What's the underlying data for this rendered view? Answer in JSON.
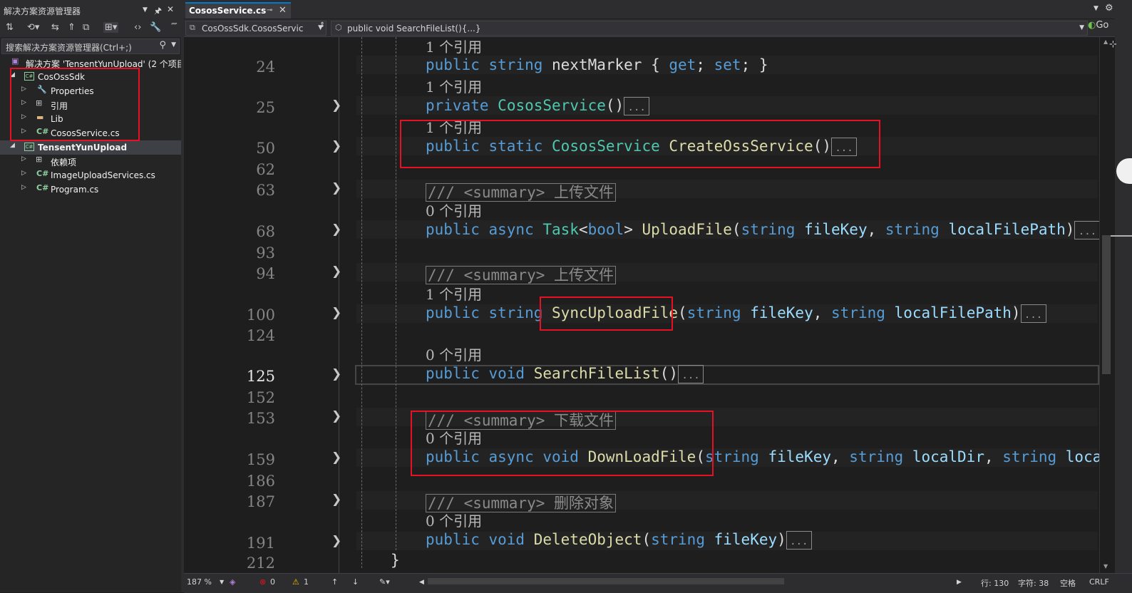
{
  "solution_explorer": {
    "title": "解决方案资源管理器",
    "pin_glyph": "🖈",
    "close_glyph": "✕",
    "toolbar_glyphs": [
      "⇅",
      "⟲▾",
      "⇆",
      "⇑",
      "⧉",
      "⊞▾",
      "‹›",
      "🔧",
      "⁗"
    ],
    "search_placeholder": "搜索解决方案资源管理器(Ctrl+;)",
    "tree": [
      {
        "label": "解决方案 'TensentYunUpload' (2 个项目",
        "icon": "solution-icon",
        "depth": 0
      },
      {
        "label": "CosOssSdk",
        "icon": "csproj-icon",
        "depth": 1,
        "expanded": true
      },
      {
        "label": "Properties",
        "icon": "wrench-icon",
        "depth": 2
      },
      {
        "label": "引用",
        "icon": "references-icon",
        "depth": 2
      },
      {
        "label": "Lib",
        "icon": "folder-icon",
        "depth": 2
      },
      {
        "label": "CososService.cs",
        "icon": "csharp-file-icon",
        "depth": 2
      },
      {
        "label": "TensentYunUpload",
        "icon": "csproj-icon",
        "depth": 1,
        "expanded": true,
        "selected": true
      },
      {
        "label": "依赖项",
        "icon": "dependencies-icon",
        "depth": 2
      },
      {
        "label": "ImageUploadServices.cs",
        "icon": "csharp-file-icon",
        "depth": 2
      },
      {
        "label": "Program.cs",
        "icon": "csharp-file-icon",
        "depth": 2
      }
    ]
  },
  "editor": {
    "tab_label": "CososService.cs",
    "tab_pin": "⊸",
    "tab_close": "✕",
    "nav_class": "CosOssSdk.CososServic",
    "nav_member": "public void SearchFileList(){...}",
    "go_label": "Go",
    "lines": [
      {
        "n": "24",
        "ref": "1 个引用"
      },
      {
        "n": "25",
        "ref": "1 个引用"
      },
      {
        "n": "50",
        "ref": "1 个引用"
      },
      {
        "n": "62"
      },
      {
        "n": "63"
      },
      {
        "n": "68",
        "ref": "0 个引用"
      },
      {
        "n": "93"
      },
      {
        "n": "94"
      },
      {
        "n": "100",
        "ref": "1 个引用"
      },
      {
        "n": "124"
      },
      {
        "n": "125",
        "ref": "0 个引用"
      },
      {
        "n": "152"
      },
      {
        "n": "153"
      },
      {
        "n": "159",
        "ref": "0 个引用"
      },
      {
        "n": "186"
      },
      {
        "n": "187"
      },
      {
        "n": "191",
        "ref": "0 个引用"
      },
      {
        "n": "212"
      }
    ],
    "summary_upload": "/// <summary> 上传文件",
    "summary_download": "/// <summary> 下载文件",
    "summary_delete": "/// <summary> 删除对象",
    "ellipsis": "...",
    "close_brace": "}"
  },
  "status_bar": {
    "zoom": "187 %",
    "errors": "0",
    "warnings": "1",
    "line": "行: 130",
    "char": "字符: 38",
    "spacing": "空格",
    "eol": "CRLF"
  },
  "colors": {
    "keyword": "#569cd6",
    "type": "#4ec9b0",
    "method": "#dcdcaa",
    "param": "#9cdcfe",
    "annotation": "#e81123",
    "accent": "#007acc"
  }
}
